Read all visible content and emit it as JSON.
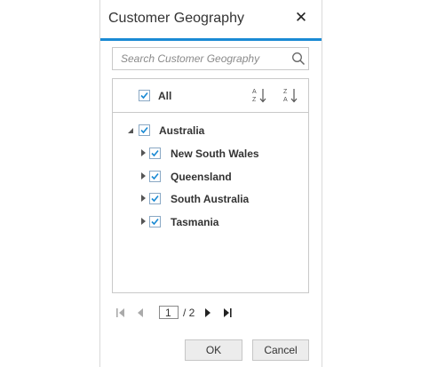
{
  "dialog": {
    "title": "Customer Geography",
    "close_symbol": "✕"
  },
  "search": {
    "placeholder": "Search Customer Geography",
    "value": ""
  },
  "list": {
    "all_label": "All",
    "all_checked": true,
    "tree": [
      {
        "label": "Australia",
        "checked": true,
        "expanded": true,
        "level": 0
      },
      {
        "label": "New South Wales",
        "checked": true,
        "expanded": false,
        "level": 1
      },
      {
        "label": "Queensland",
        "checked": true,
        "expanded": false,
        "level": 1
      },
      {
        "label": "South Australia",
        "checked": true,
        "expanded": false,
        "level": 1
      },
      {
        "label": "Tasmania",
        "checked": true,
        "expanded": false,
        "level": 1
      }
    ]
  },
  "pager": {
    "current_page": "1",
    "total_text": "/ 2"
  },
  "buttons": {
    "ok": "OK",
    "cancel": "Cancel"
  },
  "colors": {
    "accent": "#1a8ad4",
    "check": "#1a8ad4",
    "border": "#c9c9c9"
  }
}
